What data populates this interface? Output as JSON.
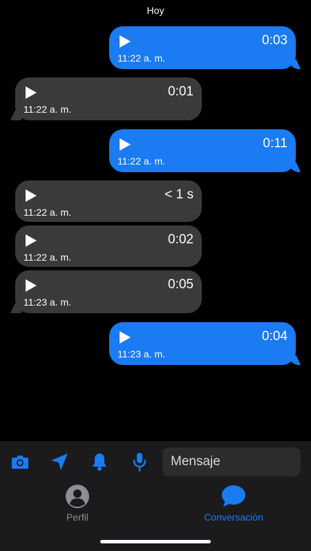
{
  "conversation": {
    "date_header": "Hoy",
    "messages": [
      {
        "direction": "out",
        "duration": "0:03",
        "time": "11:22 a. m."
      },
      {
        "direction": "in",
        "duration": "0:01",
        "time": "11:22 a. m."
      },
      {
        "direction": "out",
        "duration": "0:11",
        "time": "11:22 a. m."
      },
      {
        "direction": "in",
        "duration": "< 1 s",
        "time": "11:22 a. m."
      },
      {
        "direction": "in",
        "duration": "0:02",
        "time": "11:22 a. m."
      },
      {
        "direction": "in",
        "duration": "0:05",
        "time": "11:23 a. m."
      },
      {
        "direction": "out",
        "duration": "0:04",
        "time": "11:23 a. m."
      }
    ]
  },
  "composer": {
    "placeholder": "Mensaje",
    "icons": [
      "camera-icon",
      "location-arrow-icon",
      "bell-icon",
      "microphone-icon"
    ]
  },
  "tabs": [
    {
      "label": "Perfil",
      "icon": "person-icon",
      "active": false
    },
    {
      "label": "Conversación",
      "icon": "chat-bubble-icon",
      "active": true
    }
  ],
  "colors": {
    "accent": "#1a7bf2",
    "incoming_bubble": "#3a3a3c",
    "background": "#000000",
    "inactive_tab": "#8e8e93"
  }
}
